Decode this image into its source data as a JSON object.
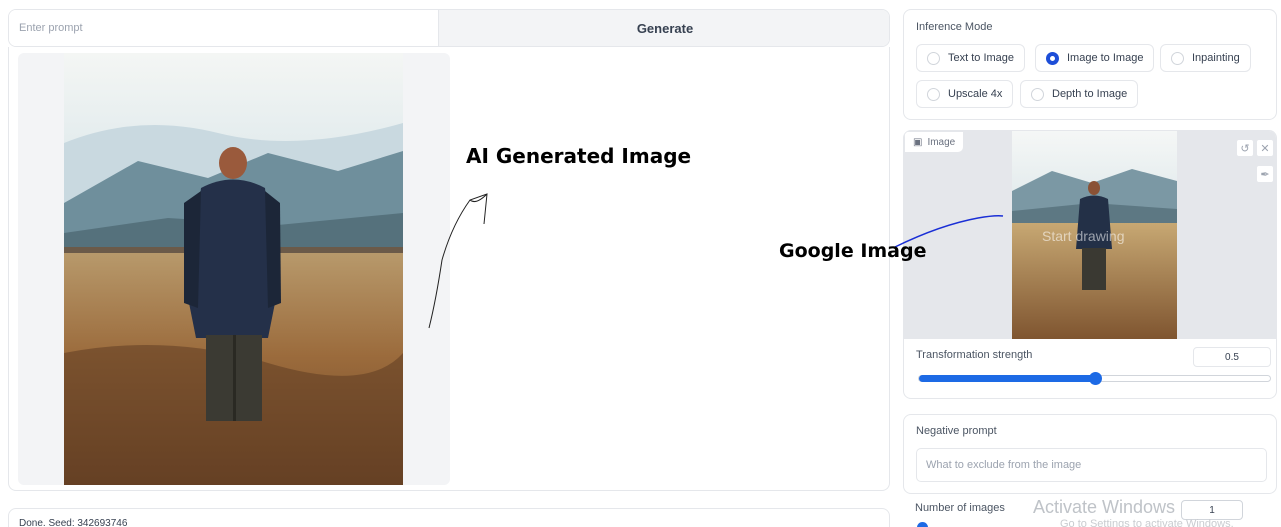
{
  "prompt": {
    "placeholder": "Enter prompt",
    "generate_label": "Generate"
  },
  "status": {
    "text": "Done. Seed: 342693746"
  },
  "inference_mode": {
    "label": "Inference Mode",
    "options": [
      {
        "label": "Text to Image",
        "selected": false
      },
      {
        "label": "Image to Image",
        "selected": true
      },
      {
        "label": "Inpainting",
        "selected": false
      },
      {
        "label": "Upscale 4x",
        "selected": false
      },
      {
        "label": "Depth to Image",
        "selected": false
      }
    ]
  },
  "image_input": {
    "label": "Image",
    "sketch_hint": "Start drawing"
  },
  "transformation_strength": {
    "label": "Transformation strength",
    "value": "0.5",
    "fraction": 0.5
  },
  "negative_prompt": {
    "label": "Negative prompt",
    "placeholder": "What to exclude from the image"
  },
  "number_of_images": {
    "label": "Number of images",
    "value": "1"
  },
  "watermark": {
    "title": "Activate Windows",
    "subtitle": "Go to Settings to activate Windows."
  },
  "annotations": {
    "ai_generated": "AI Generated Image",
    "google_image": "Google Image"
  },
  "colors": {
    "accent": "#1d6ae5",
    "selected_radio": "#1d4ed8"
  },
  "icons": {
    "image_tag": "image-icon",
    "undo": "undo-icon",
    "clear": "close-icon",
    "brush": "brush-icon"
  }
}
